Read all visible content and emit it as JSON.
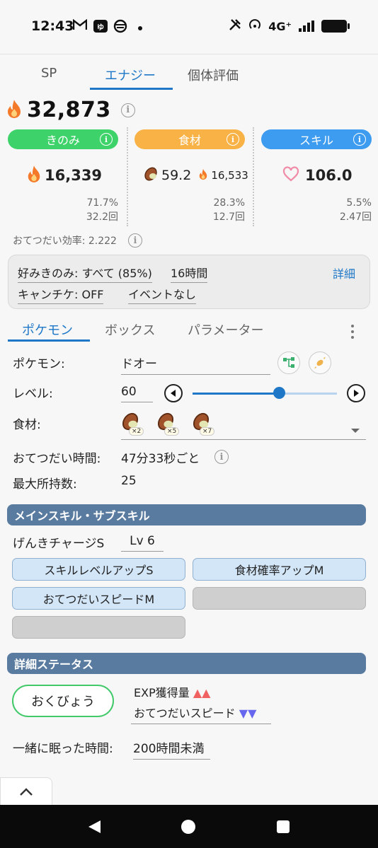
{
  "status_bar": {
    "time": "12:43",
    "network": "4G⁺"
  },
  "top_tabs": [
    "SP",
    "エナジー",
    "個体評価"
  ],
  "total_energy": "32,873",
  "columns": {
    "berry": {
      "label": "きのみ",
      "value": "16,339",
      "pct": "71.7%",
      "count": "32.2回",
      "color": "#3ed36a"
    },
    "ingredient": {
      "label": "食材",
      "amount": "59.2",
      "energy": "16,533",
      "pct": "28.3%",
      "count": "12.7回",
      "color": "#f8b245"
    },
    "skill": {
      "label": "スキル",
      "value": "106.0",
      "pct": "5.5%",
      "count": "2.47回",
      "color": "#3d9cf0"
    }
  },
  "help_efficiency": "おてつだい効率: 2.222",
  "settings": {
    "favorite": "好みきのみ: すべて (85%)",
    "duration": "16時間",
    "detail": "詳細",
    "camp": "キャンチケ: OFF",
    "event": "イベントなし"
  },
  "sub_tabs": [
    "ポケモン",
    "ボックス",
    "パラメーター"
  ],
  "pokemon": {
    "label": "ポケモン:",
    "name": "ドオー",
    "level_label": "レベル:",
    "level": "60",
    "level_fraction": 0.6,
    "ingredient_label": "食材:",
    "ingredients": [
      "×2",
      "×5",
      "×7"
    ],
    "help_time_label": "おてつだい時間:",
    "help_time": "47分33秒ごと",
    "max_carry_label": "最大所持数:",
    "max_carry": "25"
  },
  "skills_section": {
    "title": "メインスキル・サブスキル",
    "main_skill": "げんきチャージS",
    "main_level": "Lv 6",
    "sub_skills": [
      "スキルレベルアップS",
      "食材確率アップM",
      "おてつだいスピードM"
    ]
  },
  "detail_section": {
    "title": "詳細ステータス",
    "nature": "おくびょう",
    "up_stat": "EXP獲得量",
    "up_arrows": "▲▲",
    "down_stat": "おてつだいスピード",
    "down_arrows": "▼▼",
    "sleep_label": "一緒に眠った時間:",
    "sleep_value": "200時間未満"
  }
}
